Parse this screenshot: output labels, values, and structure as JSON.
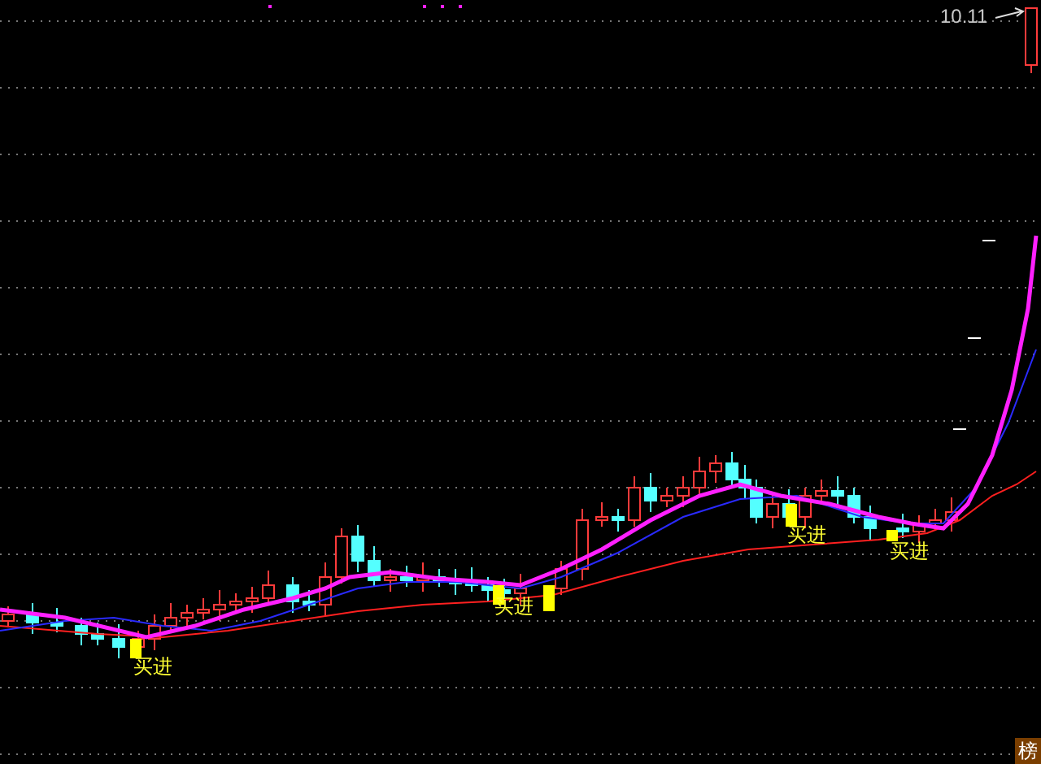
{
  "price_label": "10.11",
  "signals": [
    {
      "label": "买进"
    },
    {
      "label": "买进"
    },
    {
      "label": "买进"
    },
    {
      "label": "买进"
    }
  ],
  "corner_badge": "榜"
}
